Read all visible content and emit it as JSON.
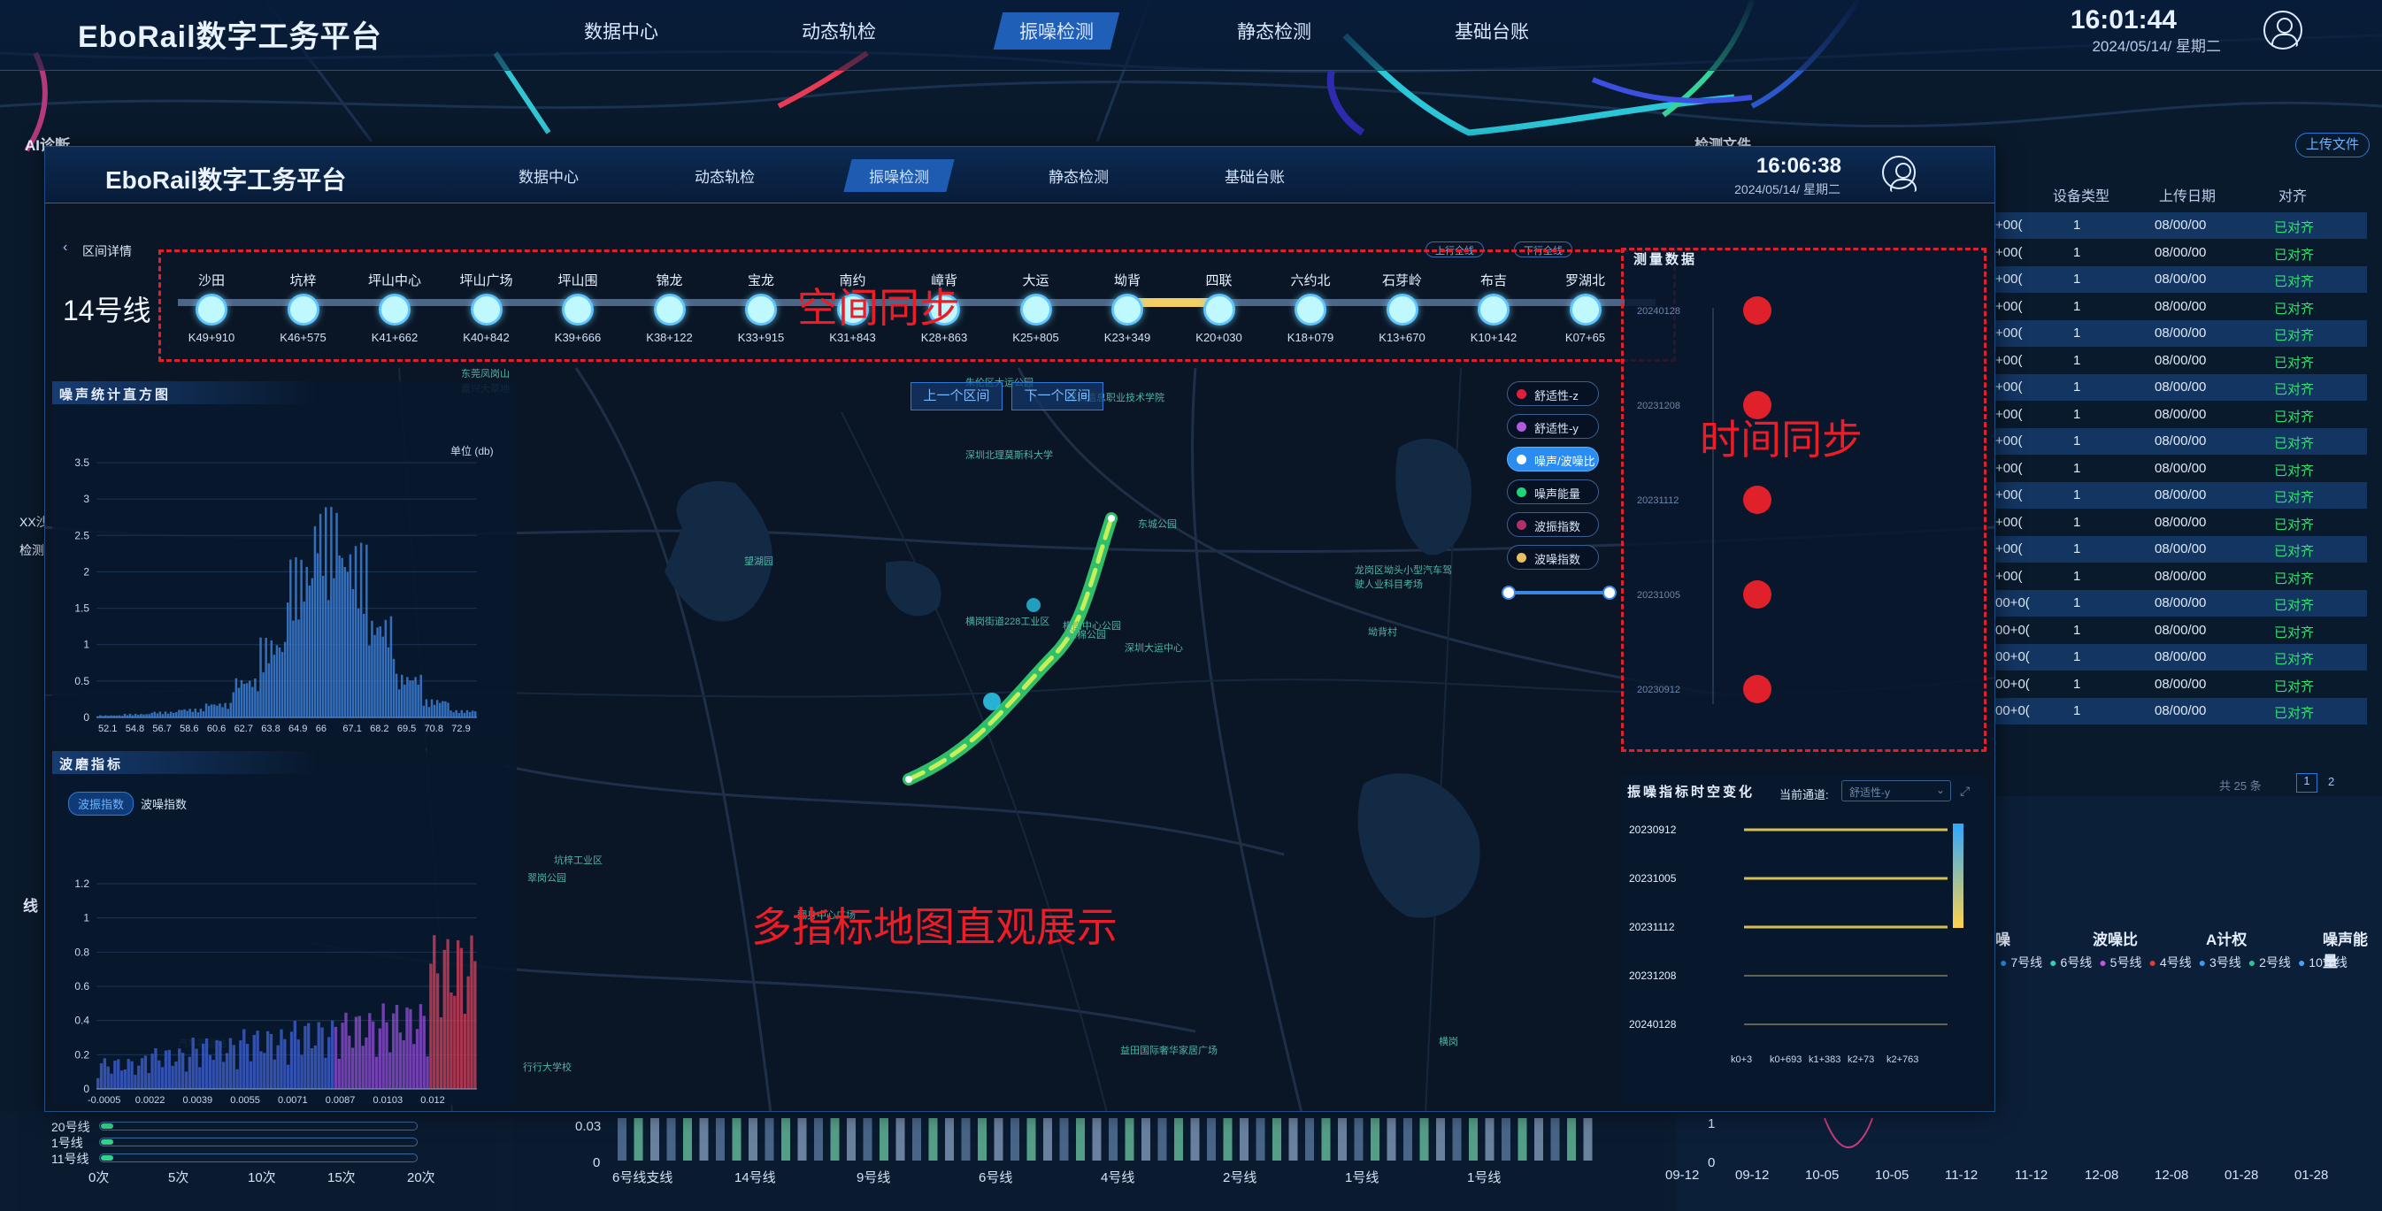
{
  "colors": {
    "accent": "#2a8cf0",
    "sync_red": "#e0202a",
    "ok_green": "#2ee36d"
  },
  "outer": {
    "title": "EboRail数字工务平台",
    "nav": [
      "数据中心",
      "动态轨检",
      "振噪检测",
      "静态检测",
      "基础台账"
    ],
    "active_nav": "振噪检测",
    "clock": "16:01:44",
    "date": "2024/05/14/ 星期二",
    "upload_btn": "上传文件",
    "table_headers": [
      "设备类型",
      "上传日期",
      "对齐"
    ],
    "table_rows": [
      {
        "a": "+00(",
        "b": "1",
        "c": "08/00/00",
        "d": "已对齐"
      },
      {
        "a": "+00(",
        "b": "1",
        "c": "08/00/00",
        "d": "已对齐"
      },
      {
        "a": "+00(",
        "b": "1",
        "c": "08/00/00",
        "d": "已对齐"
      },
      {
        "a": "+00(",
        "b": "1",
        "c": "08/00/00",
        "d": "已对齐"
      },
      {
        "a": "+00(",
        "b": "1",
        "c": "08/00/00",
        "d": "已对齐"
      },
      {
        "a": "+00(",
        "b": "1",
        "c": "08/00/00",
        "d": "已对齐"
      },
      {
        "a": "+00(",
        "b": "1",
        "c": "08/00/00",
        "d": "已对齐"
      },
      {
        "a": "+00(",
        "b": "1",
        "c": "08/00/00",
        "d": "已对齐"
      },
      {
        "a": "+00(",
        "b": "1",
        "c": "08/00/00",
        "d": "已对齐"
      },
      {
        "a": "+00(",
        "b": "1",
        "c": "08/00/00",
        "d": "已对齐"
      },
      {
        "a": "+00(",
        "b": "1",
        "c": "08/00/00",
        "d": "已对齐"
      },
      {
        "a": "+00(",
        "b": "1",
        "c": "08/00/00",
        "d": "已对齐"
      },
      {
        "a": "+00(",
        "b": "1",
        "c": "08/00/00",
        "d": "已对齐"
      },
      {
        "a": "+00(",
        "b": "1",
        "c": "08/00/00",
        "d": "已对齐"
      },
      {
        "a": "00+0(",
        "b": "1",
        "c": "08/00/00",
        "d": "已对齐"
      },
      {
        "a": "00+0(",
        "b": "1",
        "c": "08/00/00",
        "d": "已对齐"
      },
      {
        "a": "00+0(",
        "b": "1",
        "c": "08/00/00",
        "d": "已对齐"
      },
      {
        "a": "00+0(",
        "b": "1",
        "c": "08/00/00",
        "d": "已对齐"
      },
      {
        "a": "00+0(",
        "b": "1",
        "c": "08/00/00",
        "d": "已对齐"
      }
    ],
    "pager_total": "共 25 条",
    "pager_pages": [
      "1",
      "2"
    ],
    "side_labels": [
      "AI诊断",
      "线",
      "XX沙",
      "检测",
      "检测文件"
    ],
    "bottom_legend_titles": [
      "噪",
      "波噪比",
      "A计权",
      "噪声能量"
    ],
    "bottom_legend_items": [
      "7号线",
      "6号线",
      "5号线",
      "4号线",
      "3号线",
      "2号线",
      "10号线"
    ],
    "bottom_left_lines": [
      "20号线",
      "1号线",
      "11号线"
    ],
    "bottom_left_ticks": [
      "0次",
      "5次",
      "10次",
      "15次",
      "20次"
    ],
    "bottom_mid_y": [
      "0.03",
      "0"
    ],
    "bottom_mid_x": [
      "6号线支线",
      "14号线",
      "9号线",
      "6号线",
      "4号线",
      "2号线",
      "1号线",
      "1号线"
    ],
    "bottom_right_x": [
      "09-12",
      "09-12",
      "10-05",
      "10-05",
      "11-12",
      "11-12",
      "12-08",
      "12-08",
      "01-28",
      "01-28"
    ],
    "bottom_right_y": [
      "1",
      "0"
    ]
  },
  "inner": {
    "title": "EboRail数字工务平台",
    "nav": [
      "数据中心",
      "动态轨检",
      "振噪检测",
      "静态检测",
      "基础台账"
    ],
    "active_nav": "振噪检测",
    "clock": "16:06:38",
    "date": "2024/05/14/ 星期二",
    "back_label": "区间详情",
    "line_name": "14号线",
    "prev_station_btn": "上行全线",
    "next_station_btn": "下行全线",
    "stations": [
      {
        "name": "沙田",
        "km": "K49+910"
      },
      {
        "name": "坑梓",
        "km": "K46+575"
      },
      {
        "name": "坪山中心",
        "km": "K41+662"
      },
      {
        "name": "坪山广场",
        "km": "K40+842"
      },
      {
        "name": "坪山围",
        "km": "K39+666"
      },
      {
        "name": "锦龙",
        "km": "K38+122"
      },
      {
        "name": "宝龙",
        "km": "K33+915"
      },
      {
        "name": "南约",
        "km": "K31+843"
      },
      {
        "name": "嶂背",
        "km": "K28+863"
      },
      {
        "name": "大运",
        "km": "K25+805"
      },
      {
        "name": "坳背",
        "km": "K23+349"
      },
      {
        "name": "四联",
        "km": "K20+030"
      },
      {
        "name": "六约北",
        "km": "K18+079"
      },
      {
        "name": "石芽岭",
        "km": "K13+670"
      },
      {
        "name": "布吉",
        "km": "K10+142"
      },
      {
        "name": "罗湖北",
        "km": "K07+65"
      }
    ],
    "label_space_sync": "空间同步",
    "label_time_sync": "时间同步",
    "label_map": "多指标地图直观展示",
    "prev_section": "上一个区间",
    "next_section": "下一个区间",
    "layer_toggles": [
      {
        "label": "舒适性-z",
        "color": "#e0203a",
        "on": false
      },
      {
        "label": "舒适性-y",
        "color": "#b05cd8",
        "on": false
      },
      {
        "label": "噪声/波噪比",
        "color": "#ffffff",
        "on": true
      },
      {
        "label": "噪声能量",
        "color": "#21d47a",
        "on": false
      },
      {
        "label": "波振指数",
        "color": "#b0306a",
        "on": false
      },
      {
        "label": "波噪指数",
        "color": "#e8c060",
        "on": false
      }
    ],
    "noise_hist": {
      "title": "噪声统计直方图",
      "unit": "单位 (db)"
    },
    "wear_panel": {
      "title": "波磨指标",
      "tabs": [
        "波振指数",
        "波噪指数"
      ]
    },
    "measure_panel": {
      "title": "测量数据"
    },
    "spatio_panel": {
      "title": "振噪指标时空变化",
      "channel_label": "当前通道:",
      "channel_value": "舒适性-y"
    },
    "map_labels": [
      "东莞凤岗山",
      "嘉兴大草地",
      "朱伦区大运公园",
      "深圳信息职业技术学院",
      "深圳北理莫斯科大学",
      "东城公园",
      "横岗街道228工业区",
      "横岗中心公园",
      "望湖园",
      "龙岗区坳头小型汽车驾驶人业科目考场",
      "坳背村",
      "红棉公园",
      "深圳大运中心",
      "翻身中心广场",
      "翠岗公园",
      "坑梓工业区",
      "汽车客运站",
      "行行大学校",
      "益田国际奢华家居广场",
      "横岗"
    ]
  },
  "chart_data": [
    {
      "type": "bar",
      "title": "噪声统计直方图",
      "ylabel": "单位 (db)",
      "ylim": [
        0,
        3.5
      ],
      "yticks": [
        "0",
        "0.5",
        "1",
        "1.5",
        "2",
        "2.5",
        "3",
        "3.5"
      ],
      "categories": [
        "52.1",
        "54.8",
        "56.7",
        "58.6",
        "60.6",
        "62.7",
        "63.8",
        "64.9",
        "66",
        "67.1",
        "68.2",
        "69.5",
        "70.8",
        "72.9"
      ],
      "values": [
        0.03,
        0.05,
        0.08,
        0.12,
        0.2,
        0.55,
        1.1,
        2.2,
        2.9,
        2.4,
        1.4,
        0.6,
        0.25,
        0.1
      ]
    },
    {
      "type": "bar",
      "title": "波磨指标",
      "ylim": [
        0,
        1.2
      ],
      "yticks": [
        "0",
        "0.2",
        "0.4",
        "0.6",
        "0.8",
        "1",
        "1.2"
      ],
      "categories": [
        "-0.0005",
        "0.0022",
        "0.0039",
        "0.0055",
        "0.0071",
        "0.0087",
        "0.0103",
        "0.012"
      ],
      "values": [
        0.18,
        0.24,
        0.3,
        0.35,
        0.4,
        0.45,
        0.5,
        0.9
      ]
    },
    {
      "type": "scatter",
      "title": "测量数据",
      "categories": [
        "20240128",
        "20231208",
        "20231112",
        "20231005",
        "20230912"
      ],
      "values": [
        1,
        1,
        1,
        1,
        1
      ]
    },
    {
      "type": "heatmap",
      "title": "振噪指标时空变化",
      "y": [
        "20230912",
        "20231005",
        "20231112",
        "20231208",
        "20240128"
      ],
      "x": [
        "k0+3",
        "k0+693",
        "k1+383",
        "k2+73",
        "k2+763"
      ]
    }
  ]
}
